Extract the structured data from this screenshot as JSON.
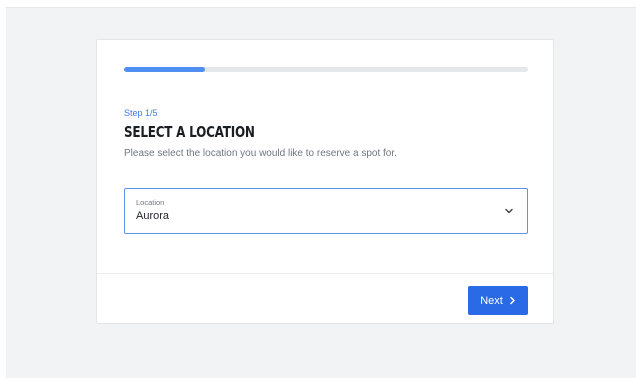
{
  "progress": {
    "current_step": 1,
    "total_steps": 5,
    "fraction": 0.2
  },
  "step": {
    "label": "Step 1/5",
    "title": "SELECT A LOCATION",
    "description": "Please select the location you would like to reserve a spot for."
  },
  "location_select": {
    "label": "Location",
    "value": "Aurora",
    "icon": "chevron-down-icon"
  },
  "footer": {
    "next_label": "Next",
    "next_icon": "chevron-right-icon"
  },
  "colors": {
    "accent": "#2a6ae6",
    "progress": "#4f8ff2",
    "step_label": "#3d7be8",
    "title": "#1b1f24",
    "muted": "#717780",
    "backdrop": "#f2f3f5"
  }
}
